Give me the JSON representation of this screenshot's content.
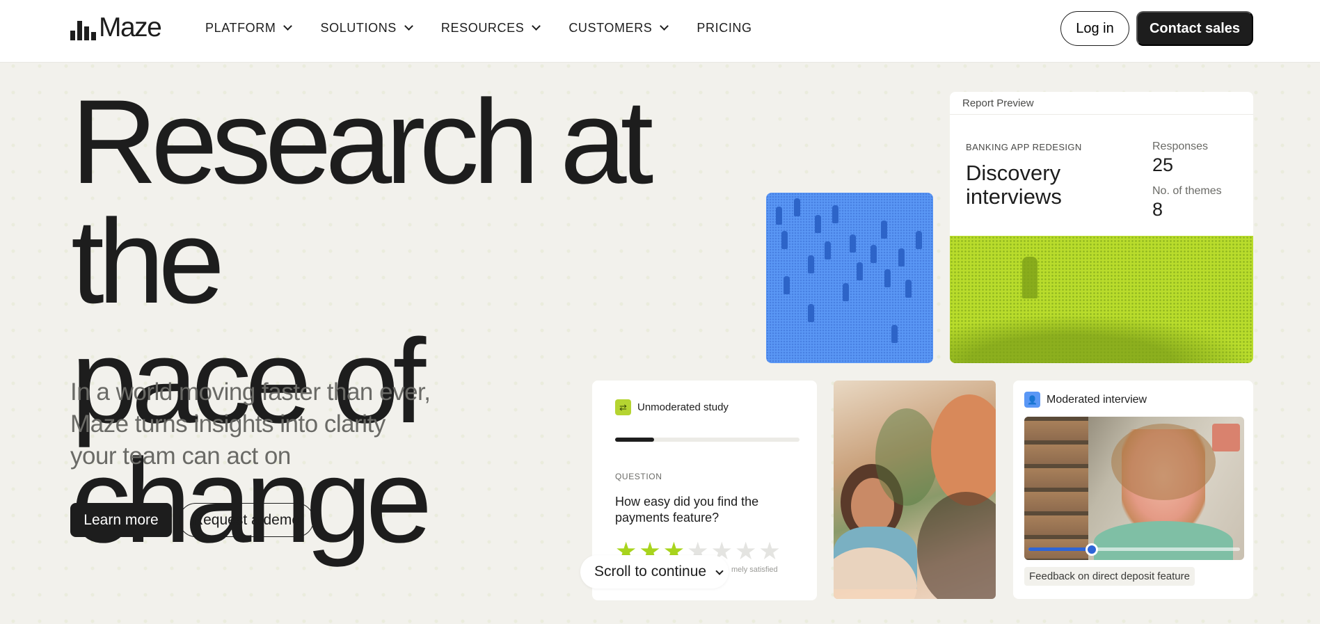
{
  "nav": {
    "logo_text": "Maze",
    "menu": [
      {
        "label": "PLATFORM",
        "has_dropdown": true
      },
      {
        "label": "SOLUTIONS",
        "has_dropdown": true
      },
      {
        "label": "RESOURCES",
        "has_dropdown": true
      },
      {
        "label": "CUSTOMERS",
        "has_dropdown": true
      },
      {
        "label": "PRICING",
        "has_dropdown": false
      }
    ],
    "login_label": "Log in",
    "contact_label": "Contact sales"
  },
  "hero": {
    "title_line1": "Research at the",
    "title_line2": "pace of change",
    "subtitle_line1": "In a world moving faster than ever,",
    "subtitle_line2": "Maze turns insights into clarity",
    "subtitle_line3": "your team can act on",
    "learn_more_label": "Learn more",
    "demo_label": "Request a demo"
  },
  "report": {
    "header": "Report Preview",
    "project_label": "BANKING APP REDESIGN",
    "title_line1": "Discovery",
    "title_line2": "interviews",
    "responses_label": "Responses",
    "responses_value": "25",
    "themes_label": "No. of themes",
    "themes_value": "8"
  },
  "study": {
    "tag": "Unmoderated study",
    "progress": 0.21,
    "question_label": "QUESTION",
    "question_text": "How easy did you find the payments feature?",
    "rating": 3,
    "rating_max": 7,
    "scale_label": "mely satisfied"
  },
  "scroll": {
    "label": "Scroll to continue"
  },
  "interview": {
    "tag": "Moderated interview",
    "video_progress": 0.3,
    "caption": "Feedback on direct deposit feature"
  },
  "colors": {
    "accent_lime": "#b9dc2c",
    "accent_blue": "#5a97f5",
    "dark": "#1d1d1d",
    "background": "#f2f1ec"
  }
}
